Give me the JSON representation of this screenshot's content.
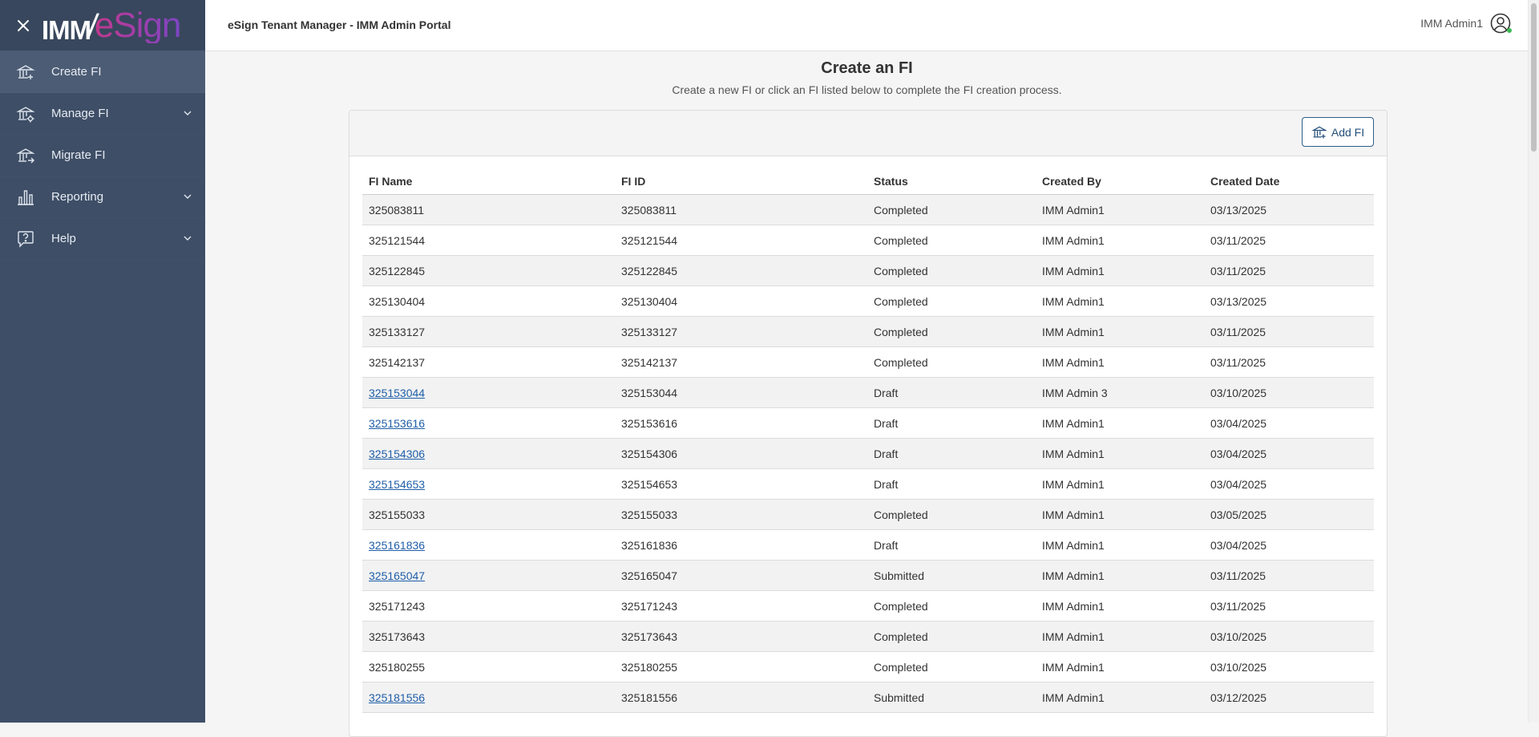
{
  "brand": {
    "logo_left": "IMM",
    "logo_slash": "/",
    "logo_right": "eSign"
  },
  "sidebar": {
    "items": [
      {
        "label": "Create FI",
        "active": true,
        "icon": "bank-add-icon",
        "expandable": false
      },
      {
        "label": "Manage FI",
        "active": false,
        "icon": "bank-gear-icon",
        "expandable": true
      },
      {
        "label": "Migrate FI",
        "active": false,
        "icon": "bank-arrow-icon",
        "expandable": false
      },
      {
        "label": "Reporting",
        "active": false,
        "icon": "bar-chart-icon",
        "expandable": true
      },
      {
        "label": "Help",
        "active": false,
        "icon": "help-bubble-icon",
        "expandable": true
      }
    ]
  },
  "header": {
    "title": "eSign Tenant Manager - IMM Admin Portal",
    "user": "IMM Admin1",
    "status_color": "#3cba54"
  },
  "page": {
    "title": "Create an FI",
    "subtitle": "Create a new FI or click an FI listed below to complete the FI creation process.",
    "add_button": "Add FI"
  },
  "table": {
    "columns": [
      "FI Name",
      "FI ID",
      "Status",
      "Created By",
      "Created Date"
    ],
    "rows": [
      {
        "name": "325083811",
        "id": "325083811",
        "status": "Completed",
        "by": "IMM Admin1",
        "date": "03/13/2025",
        "link": false
      },
      {
        "name": "325121544",
        "id": "325121544",
        "status": "Completed",
        "by": "IMM Admin1",
        "date": "03/11/2025",
        "link": false
      },
      {
        "name": "325122845",
        "id": "325122845",
        "status": "Completed",
        "by": "IMM Admin1",
        "date": "03/11/2025",
        "link": false
      },
      {
        "name": "325130404",
        "id": "325130404",
        "status": "Completed",
        "by": "IMM Admin1",
        "date": "03/13/2025",
        "link": false
      },
      {
        "name": "325133127",
        "id": "325133127",
        "status": "Completed",
        "by": "IMM Admin1",
        "date": "03/11/2025",
        "link": false
      },
      {
        "name": "325142137",
        "id": "325142137",
        "status": "Completed",
        "by": "IMM Admin1",
        "date": "03/11/2025",
        "link": false
      },
      {
        "name": "325153044",
        "id": "325153044",
        "status": "Draft",
        "by": "IMM Admin 3",
        "date": "03/10/2025",
        "link": true
      },
      {
        "name": "325153616",
        "id": "325153616",
        "status": "Draft",
        "by": "IMM Admin1",
        "date": "03/04/2025",
        "link": true
      },
      {
        "name": "325154306",
        "id": "325154306",
        "status": "Draft",
        "by": "IMM Admin1",
        "date": "03/04/2025",
        "link": true
      },
      {
        "name": "325154653",
        "id": "325154653",
        "status": "Draft",
        "by": "IMM Admin1",
        "date": "03/04/2025",
        "link": true
      },
      {
        "name": "325155033",
        "id": "325155033",
        "status": "Completed",
        "by": "IMM Admin1",
        "date": "03/05/2025",
        "link": false
      },
      {
        "name": "325161836",
        "id": "325161836",
        "status": "Draft",
        "by": "IMM Admin1",
        "date": "03/04/2025",
        "link": true
      },
      {
        "name": "325165047",
        "id": "325165047",
        "status": "Submitted",
        "by": "IMM Admin1",
        "date": "03/11/2025",
        "link": true
      },
      {
        "name": "325171243",
        "id": "325171243",
        "status": "Completed",
        "by": "IMM Admin1",
        "date": "03/11/2025",
        "link": false
      },
      {
        "name": "325173643",
        "id": "325173643",
        "status": "Completed",
        "by": "IMM Admin1",
        "date": "03/10/2025",
        "link": false
      },
      {
        "name": "325180255",
        "id": "325180255",
        "status": "Completed",
        "by": "IMM Admin1",
        "date": "03/10/2025",
        "link": false
      },
      {
        "name": "325181556",
        "id": "325181556",
        "status": "Submitted",
        "by": "IMM Admin1",
        "date": "03/12/2025",
        "link": true
      }
    ]
  }
}
